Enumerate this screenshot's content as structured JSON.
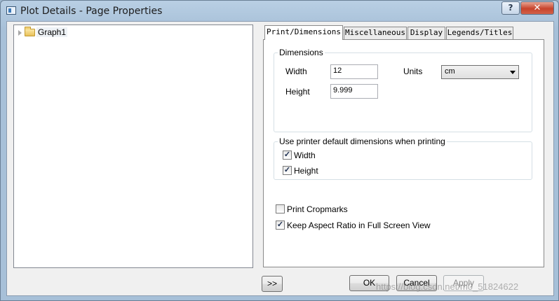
{
  "window": {
    "title": "Plot Details - Page Properties",
    "help_label": "?",
    "close_label": "✕"
  },
  "tree": {
    "items": [
      {
        "label": "Graph1",
        "icon": "folder-icon"
      }
    ]
  },
  "tabs": [
    {
      "label": "Print/Dimensions",
      "active": true
    },
    {
      "label": "Miscellaneous",
      "active": false
    },
    {
      "label": "Display",
      "active": false
    },
    {
      "label": "Legends/Titles",
      "active": false
    }
  ],
  "dimensions": {
    "group_title": "Dimensions",
    "width_label": "Width",
    "width_value": "12",
    "height_label": "Height",
    "height_value": "9.999",
    "units_label": "Units",
    "units_value": "cm"
  },
  "printer": {
    "group_title": "Use printer default dimensions when printing",
    "width_label": "Width",
    "width_checked": true,
    "height_label": "Height",
    "height_checked": true
  },
  "options": {
    "cropmarks_label": "Print Cropmarks",
    "cropmarks_checked": false,
    "aspect_label": "Keep Aspect Ratio in Full Screen View",
    "aspect_checked": true
  },
  "buttons": {
    "expand": ">>",
    "ok": "OK",
    "cancel": "Cancel",
    "apply": "Apply"
  },
  "watermark": "https://blog.csdn.net/m0_51824622",
  "colors": {
    "title_bar": "#a7c0d8",
    "close_button": "#c7432b",
    "check_mark": "#1b2d4f"
  }
}
